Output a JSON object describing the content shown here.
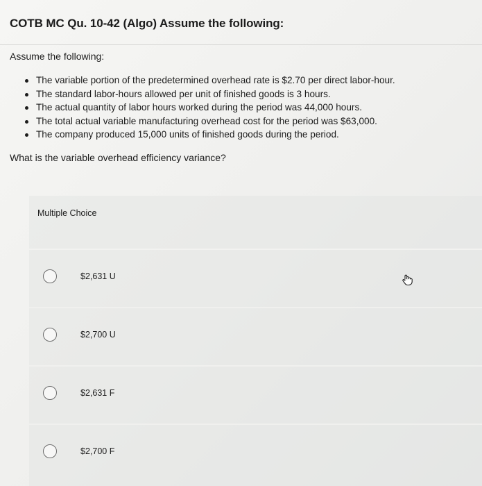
{
  "header": {
    "title": "COTB MC Qu. 10-42 (Algo) Assume the following:"
  },
  "question": {
    "intro": "Assume the following:",
    "bullets": [
      "The variable portion of the predetermined overhead rate is $2.70 per direct labor-hour.",
      "The standard labor-hours allowed per unit of finished goods is 3 hours.",
      "The actual quantity of labor hours worked during the period was 44,000 hours.",
      "The total actual variable manufacturing overhead cost for the period was $63,000.",
      "The company produced 15,000 units of finished goods during the period."
    ],
    "prompt": "What is the variable overhead efficiency variance?"
  },
  "multiple_choice": {
    "label": "Multiple Choice",
    "options": [
      {
        "label": "$2,631 U",
        "selected": false
      },
      {
        "label": "$2,700 U",
        "selected": false
      },
      {
        "label": "$2,631 F",
        "selected": false
      },
      {
        "label": "$2,700 F",
        "selected": false
      }
    ]
  },
  "cursor": {
    "icon": "pointer-hand-icon"
  }
}
